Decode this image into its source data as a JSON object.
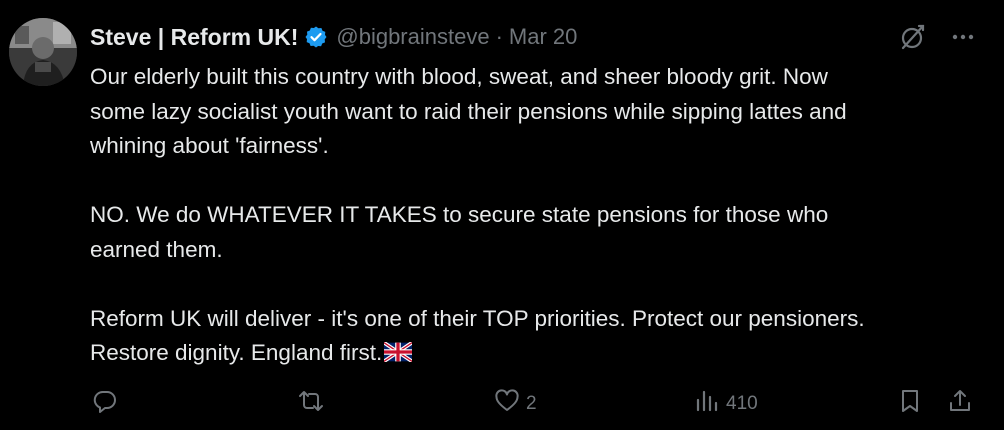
{
  "author": {
    "display_name": "Steve | Reform UK!",
    "handle": "@bigbrainsteve",
    "separator": "·",
    "date": "Mar 20"
  },
  "tweet": {
    "text": "Our elderly built this country with blood, sweat, and sheer bloody grit. Now\nsome lazy socialist youth want to raid their pensions while sipping lattes and\nwhining about 'fairness'.\n\nNO. We do WHATEVER IT TAKES to secure state pensions for those who\nearned them.\n\nReform UK will deliver - it's one of their TOP priorities. Protect our pensioners.\nRestore dignity. England first."
  },
  "metrics": {
    "replies": "",
    "reposts": "",
    "likes": "2",
    "views": "410"
  },
  "icons": {
    "verified": "verified-badge-icon",
    "grok": "grok-icon",
    "more": "more-icon",
    "flag": "uk-flag-icon",
    "reply": "reply-icon",
    "repost": "repost-icon",
    "like": "heart-icon",
    "views": "views-icon",
    "bookmark": "bookmark-icon",
    "share": "share-icon"
  },
  "colors": {
    "background": "#000000",
    "text": "#e7e9ea",
    "muted": "#71767b",
    "verified": "#1d9bf0"
  }
}
